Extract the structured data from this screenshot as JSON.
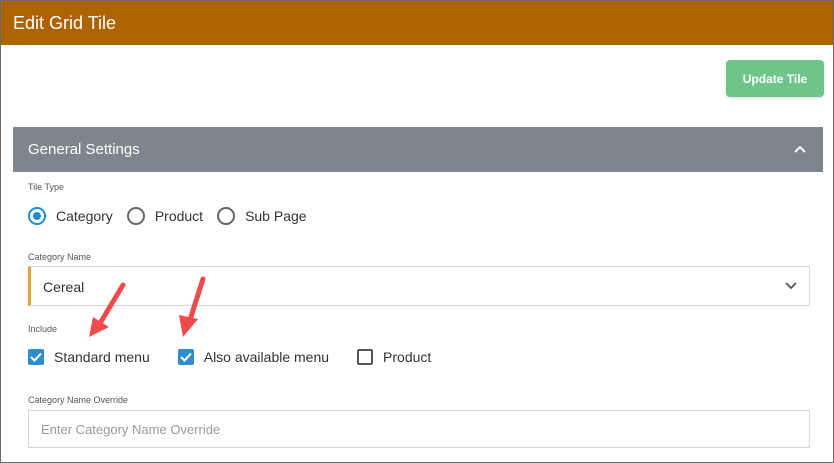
{
  "window": {
    "title": "Edit Grid Tile"
  },
  "toolbar": {
    "update_label": "Update Tile"
  },
  "section": {
    "title": "General Settings"
  },
  "tile_type": {
    "label": "Tile Type",
    "options": [
      {
        "label": "Category",
        "selected": true
      },
      {
        "label": "Product",
        "selected": false
      },
      {
        "label": "Sub Page",
        "selected": false
      }
    ]
  },
  "category_name": {
    "label": "Category Name",
    "value": "Cereal"
  },
  "include": {
    "label": "Include",
    "options": [
      {
        "label": "Standard menu",
        "checked": true
      },
      {
        "label": "Also available menu",
        "checked": true
      },
      {
        "label": "Product",
        "checked": false
      }
    ]
  },
  "override": {
    "label": "Category Name Override",
    "placeholder": "Enter Category Name Override"
  },
  "colors": {
    "titlebar": "#ae6200",
    "update_button": "#6fc48a",
    "section_header": "#7c868b",
    "accent_blue": "#1a8fd0",
    "annotation_arrow": "#f04a4a"
  },
  "icons": {
    "collapse": "chevron-up-icon",
    "select": "chevron-down-icon",
    "annotation": "red-arrow-icon"
  }
}
